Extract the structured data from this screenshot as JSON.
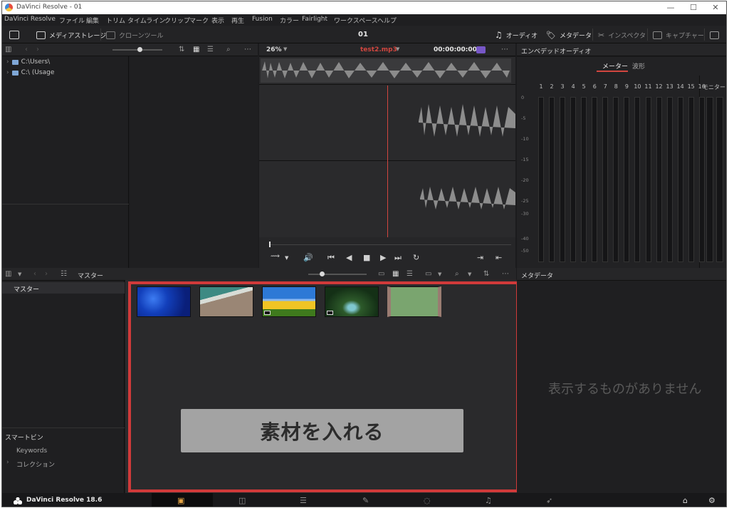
{
  "window": {
    "title": "DaVinci Resolve - 01",
    "controls": [
      "—",
      "☐",
      "✕"
    ]
  },
  "menu": [
    "DaVinci Resolve",
    "ファイル",
    "編集",
    "トリム",
    "タイムライン",
    "クリップ",
    "マーク",
    "表示",
    "再生",
    "Fusion",
    "カラー",
    "Fairlight",
    "ワークスペース",
    "ヘルプ"
  ],
  "toolbar": {
    "media_storage": "メディアストレージ",
    "clone_tool": "クローンツール",
    "project_name": "01",
    "audio": "オーディオ",
    "metadata": "メタデータ",
    "inspector": "インスペクタ",
    "capture": "キャプチャー"
  },
  "storage": {
    "items": [
      "C:\\Users\\",
      "C:\\ (Usage"
    ]
  },
  "viewer": {
    "zoom": "26%",
    "clip_name": "test2.mp3",
    "clip_name_color": "#d2463f",
    "timecode": "00:00:00:00",
    "playhead_color": "#d2463f"
  },
  "audio_panel": {
    "title": "エンベデッドオーディオ",
    "tabs": [
      "メーター",
      "波形"
    ],
    "active_tab": "メーター",
    "channels": [
      "1",
      "2",
      "3",
      "4",
      "5",
      "6",
      "7",
      "8",
      "9",
      "10",
      "11",
      "12",
      "13",
      "14",
      "15",
      "16"
    ],
    "monitor_label": "モニター",
    "db_scale": [
      "0",
      "-5",
      "-10",
      "-15",
      "-20",
      "-25",
      "-30",
      "-40",
      "-50"
    ]
  },
  "media_pool": {
    "header_label": "マスター",
    "bin_master": "マスター",
    "smart_bins": "スマートビン",
    "keywords": "Keywords",
    "collections": "コレクション",
    "cta_text": "素材を入れる",
    "highlight_color": "#d03a3a"
  },
  "metadata_panel": {
    "title": "メタデータ",
    "empty_message": "表示するものがありません"
  },
  "footer": {
    "brand": "DaVinci Resolve 18.6"
  }
}
